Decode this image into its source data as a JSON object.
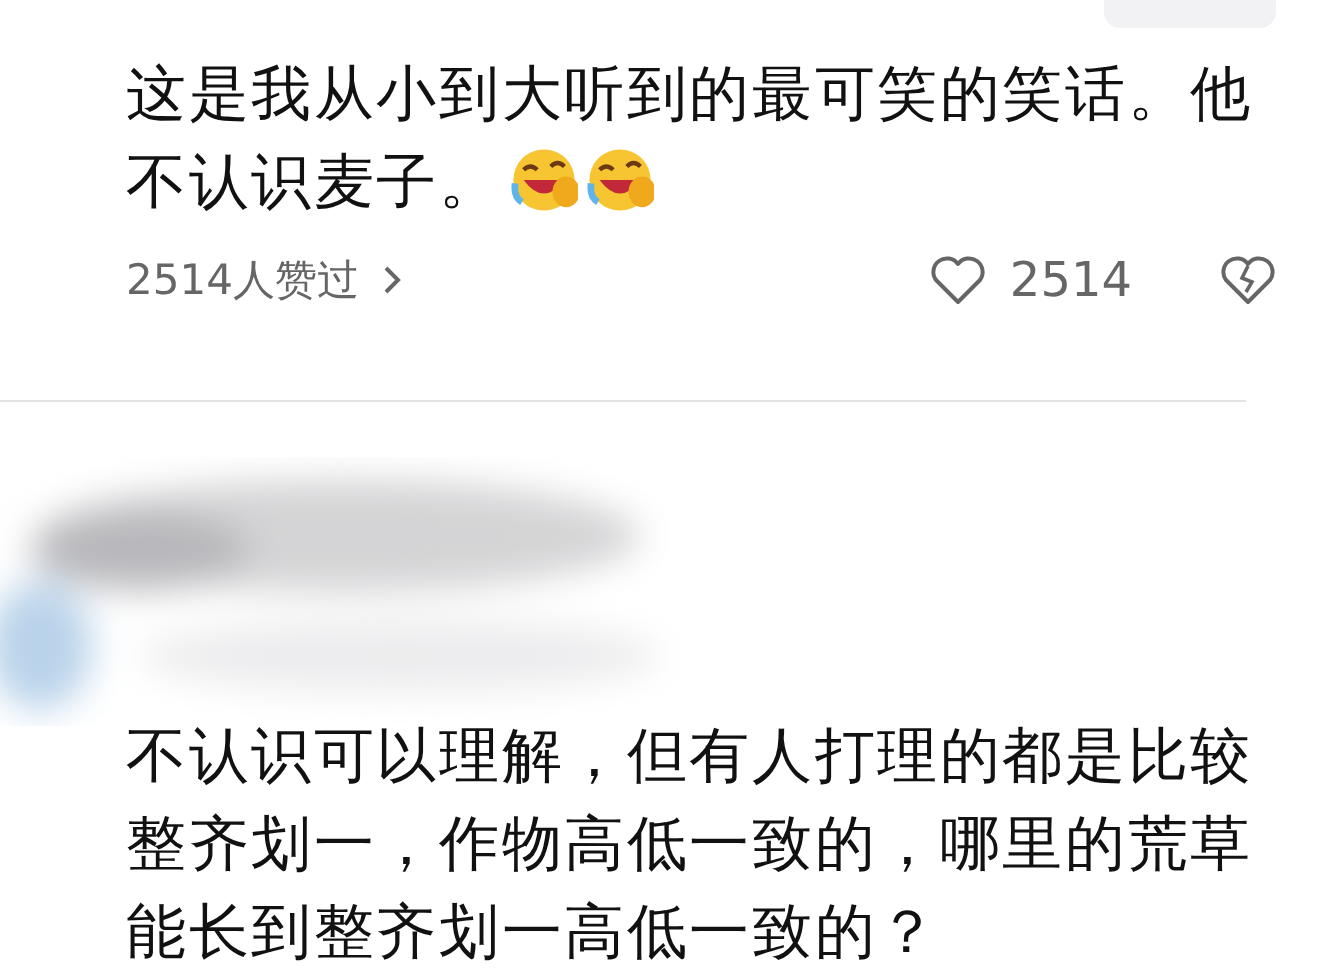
{
  "comments": [
    {
      "text": "这是我从小到大听到的最可笑的笑话。他不认识麦子。",
      "emojis": [
        {
          "kind": "laugh-cry"
        },
        {
          "kind": "laugh-cry"
        }
      ],
      "likers": "2514人赞过",
      "likes": "2514",
      "blurred_header": false
    },
    {
      "text": "不认识可以理解，但有人打理的都是比较整齐划一，作物高低一致的，哪里的荒草能长到整齐划一高低一致的？",
      "blurred_header": true
    }
  ]
}
